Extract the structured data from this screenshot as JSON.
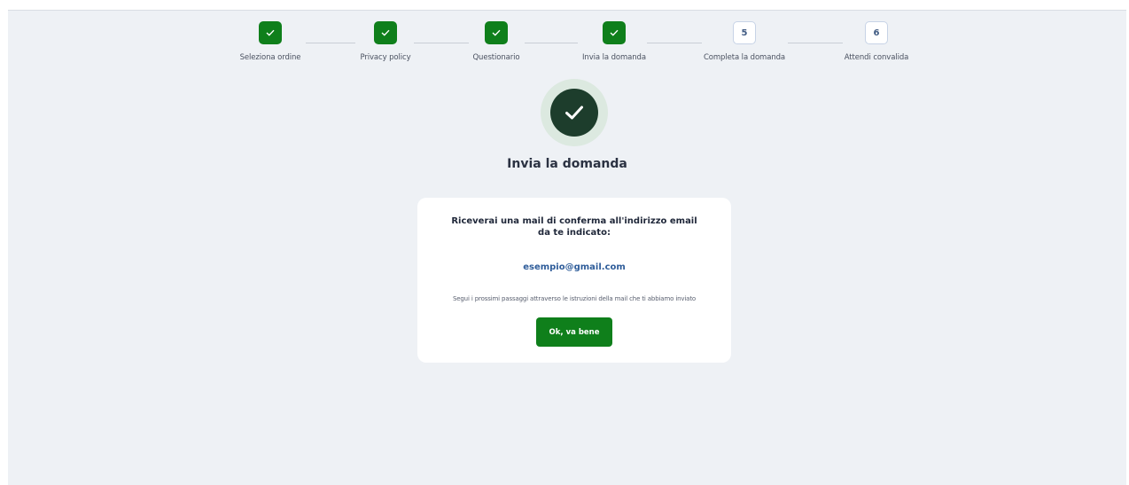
{
  "stepper": {
    "steps": [
      {
        "label": "Seleziona ordine",
        "status": "done",
        "number": ""
      },
      {
        "label": "Privacy policy",
        "status": "done",
        "number": ""
      },
      {
        "label": "Questionario",
        "status": "done",
        "number": ""
      },
      {
        "label": "Invia la domanda",
        "status": "done",
        "number": ""
      },
      {
        "label": "Completa la domanda",
        "status": "todo",
        "number": "5"
      },
      {
        "label": "Attendi convalida",
        "status": "todo",
        "number": "6"
      }
    ]
  },
  "main": {
    "title": "Invia la domanda",
    "success_icon": "check-circle-icon"
  },
  "card": {
    "heading": "Riceverai una mail di conferma all'indirizzo email da te indicato:",
    "email": "esempio@gmail.com",
    "instructions": "Segui i prossimi passaggi attraverso le istruzioni della mail che ti abbiamo inviato",
    "ok_label": "Ok, va bene"
  },
  "colors": {
    "primary_green": "#0f7f1b",
    "dark_check": "#1d3d2c",
    "email_blue": "#2f5d9a",
    "background": "#eef1f5"
  }
}
